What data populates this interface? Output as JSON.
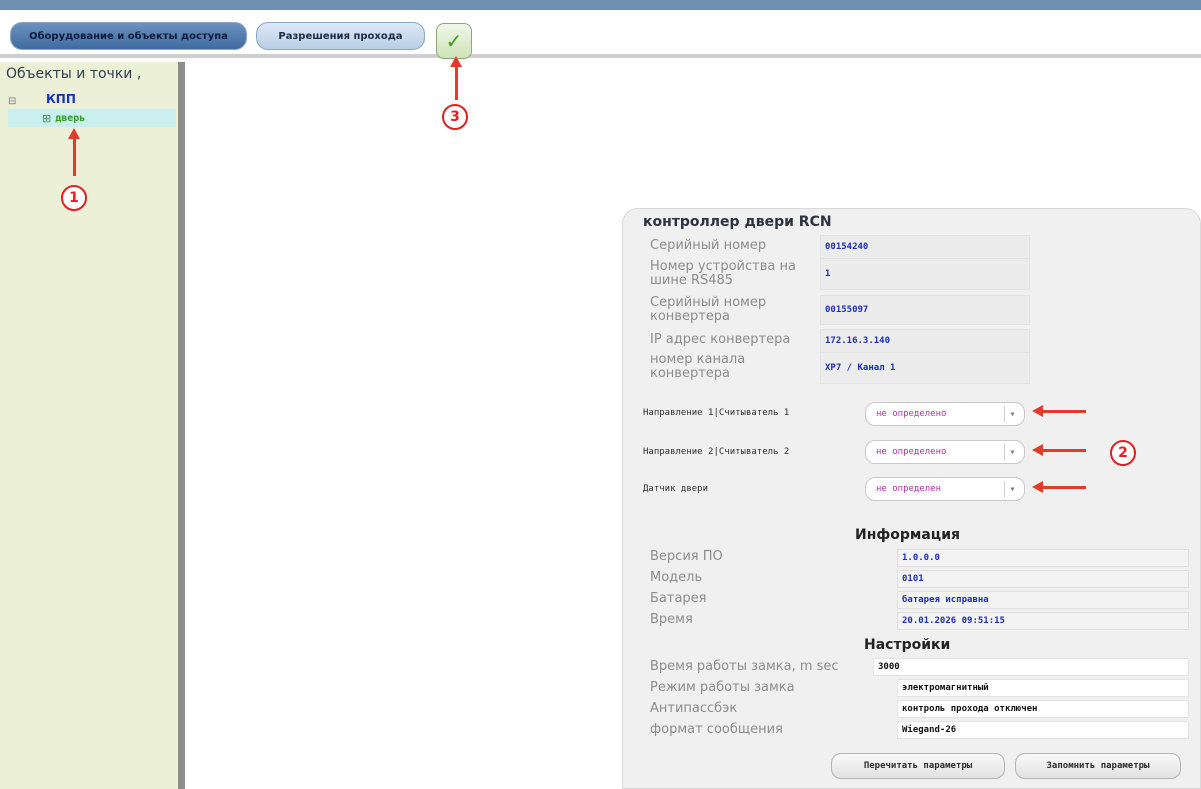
{
  "header": {
    "tab_active": "Оборудование и объекты доступа",
    "tab_inactive": "Разрешения прохода",
    "apply_icon": "checkmark-icon"
  },
  "sidebar": {
    "title": "Объекты и точки ,",
    "toggle": "⊟",
    "root": "КПП",
    "child": "дверь"
  },
  "markers": {
    "m1": "1",
    "m2": "2",
    "m3": "3"
  },
  "panel": {
    "title": "контроллер двери RCN",
    "fields": [
      {
        "label": "Серийный номер",
        "value": "00154240"
      },
      {
        "label": "Номер устройства на шине RS485",
        "value": "1"
      },
      {
        "label": "Серийный номер конвертера",
        "value": "00155097"
      },
      {
        "label": "IP адрес конвертера",
        "value": "172.16.3.140"
      },
      {
        "label": "номер канала конвертера",
        "value": "XP7 / Канал 1"
      }
    ],
    "selects": [
      {
        "label": "Направление 1|Считыватель 1",
        "value": "не определено"
      },
      {
        "label": "Направление 2|Считыватель 2",
        "value": "не определено"
      },
      {
        "label": "Датчик двери",
        "value": "не определен"
      }
    ],
    "info": {
      "title": "Информация",
      "rows": [
        {
          "label": "Версия ПО",
          "value": "1.0.0.0"
        },
        {
          "label": "Модель",
          "value": "0101"
        },
        {
          "label": "Батарея",
          "value": "батарея исправна"
        },
        {
          "label": "Время",
          "value": "20.01.2026 09:51:15"
        }
      ]
    },
    "settings": {
      "title": "Настройки",
      "rows": [
        {
          "label": "Время работы замка, m sec",
          "value": "3000"
        },
        {
          "label": "Режим работы замка",
          "value": "электромагнитный"
        },
        {
          "label": "Антипассбэк",
          "value": "контроль прохода отключен"
        },
        {
          "label": "формат сообщения",
          "value": "Wiegand-26"
        }
      ]
    },
    "btn_reread": "Перечитать параметры",
    "btn_save": "Запомнить параметры"
  },
  "colors": {
    "accent": "#3f6b9f",
    "annotation": "#e02020",
    "value_text": "#1c2fb8",
    "select_text": "#b033a8"
  }
}
